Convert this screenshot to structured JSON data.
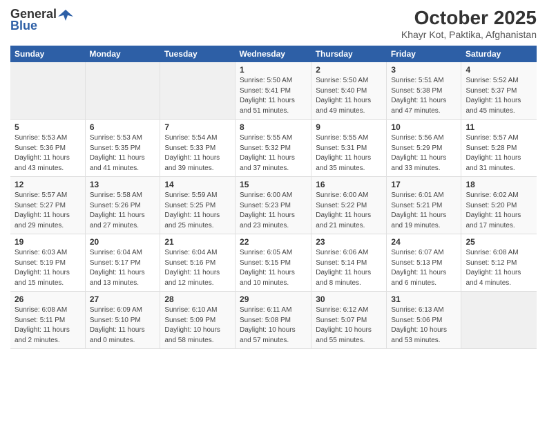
{
  "logo": {
    "general": "General",
    "blue": "Blue"
  },
  "title": "October 2025",
  "subtitle": "Khayr Kot, Paktika, Afghanistan",
  "days_of_week": [
    "Sunday",
    "Monday",
    "Tuesday",
    "Wednesday",
    "Thursday",
    "Friday",
    "Saturday"
  ],
  "weeks": [
    [
      {
        "day": "",
        "content": ""
      },
      {
        "day": "",
        "content": ""
      },
      {
        "day": "",
        "content": ""
      },
      {
        "day": "1",
        "content": "Sunrise: 5:50 AM\nSunset: 5:41 PM\nDaylight: 11 hours\nand 51 minutes."
      },
      {
        "day": "2",
        "content": "Sunrise: 5:50 AM\nSunset: 5:40 PM\nDaylight: 11 hours\nand 49 minutes."
      },
      {
        "day": "3",
        "content": "Sunrise: 5:51 AM\nSunset: 5:38 PM\nDaylight: 11 hours\nand 47 minutes."
      },
      {
        "day": "4",
        "content": "Sunrise: 5:52 AM\nSunset: 5:37 PM\nDaylight: 11 hours\nand 45 minutes."
      }
    ],
    [
      {
        "day": "5",
        "content": "Sunrise: 5:53 AM\nSunset: 5:36 PM\nDaylight: 11 hours\nand 43 minutes."
      },
      {
        "day": "6",
        "content": "Sunrise: 5:53 AM\nSunset: 5:35 PM\nDaylight: 11 hours\nand 41 minutes."
      },
      {
        "day": "7",
        "content": "Sunrise: 5:54 AM\nSunset: 5:33 PM\nDaylight: 11 hours\nand 39 minutes."
      },
      {
        "day": "8",
        "content": "Sunrise: 5:55 AM\nSunset: 5:32 PM\nDaylight: 11 hours\nand 37 minutes."
      },
      {
        "day": "9",
        "content": "Sunrise: 5:55 AM\nSunset: 5:31 PM\nDaylight: 11 hours\nand 35 minutes."
      },
      {
        "day": "10",
        "content": "Sunrise: 5:56 AM\nSunset: 5:29 PM\nDaylight: 11 hours\nand 33 minutes."
      },
      {
        "day": "11",
        "content": "Sunrise: 5:57 AM\nSunset: 5:28 PM\nDaylight: 11 hours\nand 31 minutes."
      }
    ],
    [
      {
        "day": "12",
        "content": "Sunrise: 5:57 AM\nSunset: 5:27 PM\nDaylight: 11 hours\nand 29 minutes."
      },
      {
        "day": "13",
        "content": "Sunrise: 5:58 AM\nSunset: 5:26 PM\nDaylight: 11 hours\nand 27 minutes."
      },
      {
        "day": "14",
        "content": "Sunrise: 5:59 AM\nSunset: 5:25 PM\nDaylight: 11 hours\nand 25 minutes."
      },
      {
        "day": "15",
        "content": "Sunrise: 6:00 AM\nSunset: 5:23 PM\nDaylight: 11 hours\nand 23 minutes."
      },
      {
        "day": "16",
        "content": "Sunrise: 6:00 AM\nSunset: 5:22 PM\nDaylight: 11 hours\nand 21 minutes."
      },
      {
        "day": "17",
        "content": "Sunrise: 6:01 AM\nSunset: 5:21 PM\nDaylight: 11 hours\nand 19 minutes."
      },
      {
        "day": "18",
        "content": "Sunrise: 6:02 AM\nSunset: 5:20 PM\nDaylight: 11 hours\nand 17 minutes."
      }
    ],
    [
      {
        "day": "19",
        "content": "Sunrise: 6:03 AM\nSunset: 5:19 PM\nDaylight: 11 hours\nand 15 minutes."
      },
      {
        "day": "20",
        "content": "Sunrise: 6:04 AM\nSunset: 5:17 PM\nDaylight: 11 hours\nand 13 minutes."
      },
      {
        "day": "21",
        "content": "Sunrise: 6:04 AM\nSunset: 5:16 PM\nDaylight: 11 hours\nand 12 minutes."
      },
      {
        "day": "22",
        "content": "Sunrise: 6:05 AM\nSunset: 5:15 PM\nDaylight: 11 hours\nand 10 minutes."
      },
      {
        "day": "23",
        "content": "Sunrise: 6:06 AM\nSunset: 5:14 PM\nDaylight: 11 hours\nand 8 minutes."
      },
      {
        "day": "24",
        "content": "Sunrise: 6:07 AM\nSunset: 5:13 PM\nDaylight: 11 hours\nand 6 minutes."
      },
      {
        "day": "25",
        "content": "Sunrise: 6:08 AM\nSunset: 5:12 PM\nDaylight: 11 hours\nand 4 minutes."
      }
    ],
    [
      {
        "day": "26",
        "content": "Sunrise: 6:08 AM\nSunset: 5:11 PM\nDaylight: 11 hours\nand 2 minutes."
      },
      {
        "day": "27",
        "content": "Sunrise: 6:09 AM\nSunset: 5:10 PM\nDaylight: 11 hours\nand 0 minutes."
      },
      {
        "day": "28",
        "content": "Sunrise: 6:10 AM\nSunset: 5:09 PM\nDaylight: 10 hours\nand 58 minutes."
      },
      {
        "day": "29",
        "content": "Sunrise: 6:11 AM\nSunset: 5:08 PM\nDaylight: 10 hours\nand 57 minutes."
      },
      {
        "day": "30",
        "content": "Sunrise: 6:12 AM\nSunset: 5:07 PM\nDaylight: 10 hours\nand 55 minutes."
      },
      {
        "day": "31",
        "content": "Sunrise: 6:13 AM\nSunset: 5:06 PM\nDaylight: 10 hours\nand 53 minutes."
      },
      {
        "day": "",
        "content": ""
      }
    ]
  ]
}
